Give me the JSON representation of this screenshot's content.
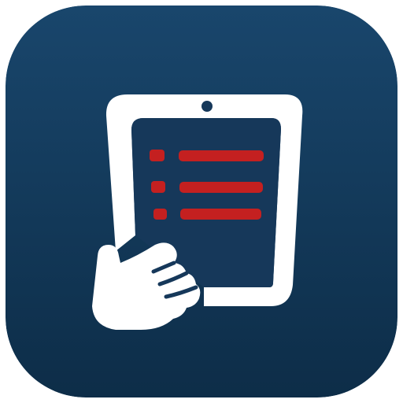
{
  "icon": {
    "name": "tablet-checklist-app-icon",
    "symbol": "tablet-icon",
    "list_icon": "checklist-icon",
    "hand_icon": "hand-icon"
  },
  "colors": {
    "background_top": "#19466c",
    "background_bottom": "#0d2d48",
    "tablet_frame": "#ffffff",
    "screen": "#16385a",
    "list_accent": "#c42020",
    "hand": "#ffffff"
  }
}
